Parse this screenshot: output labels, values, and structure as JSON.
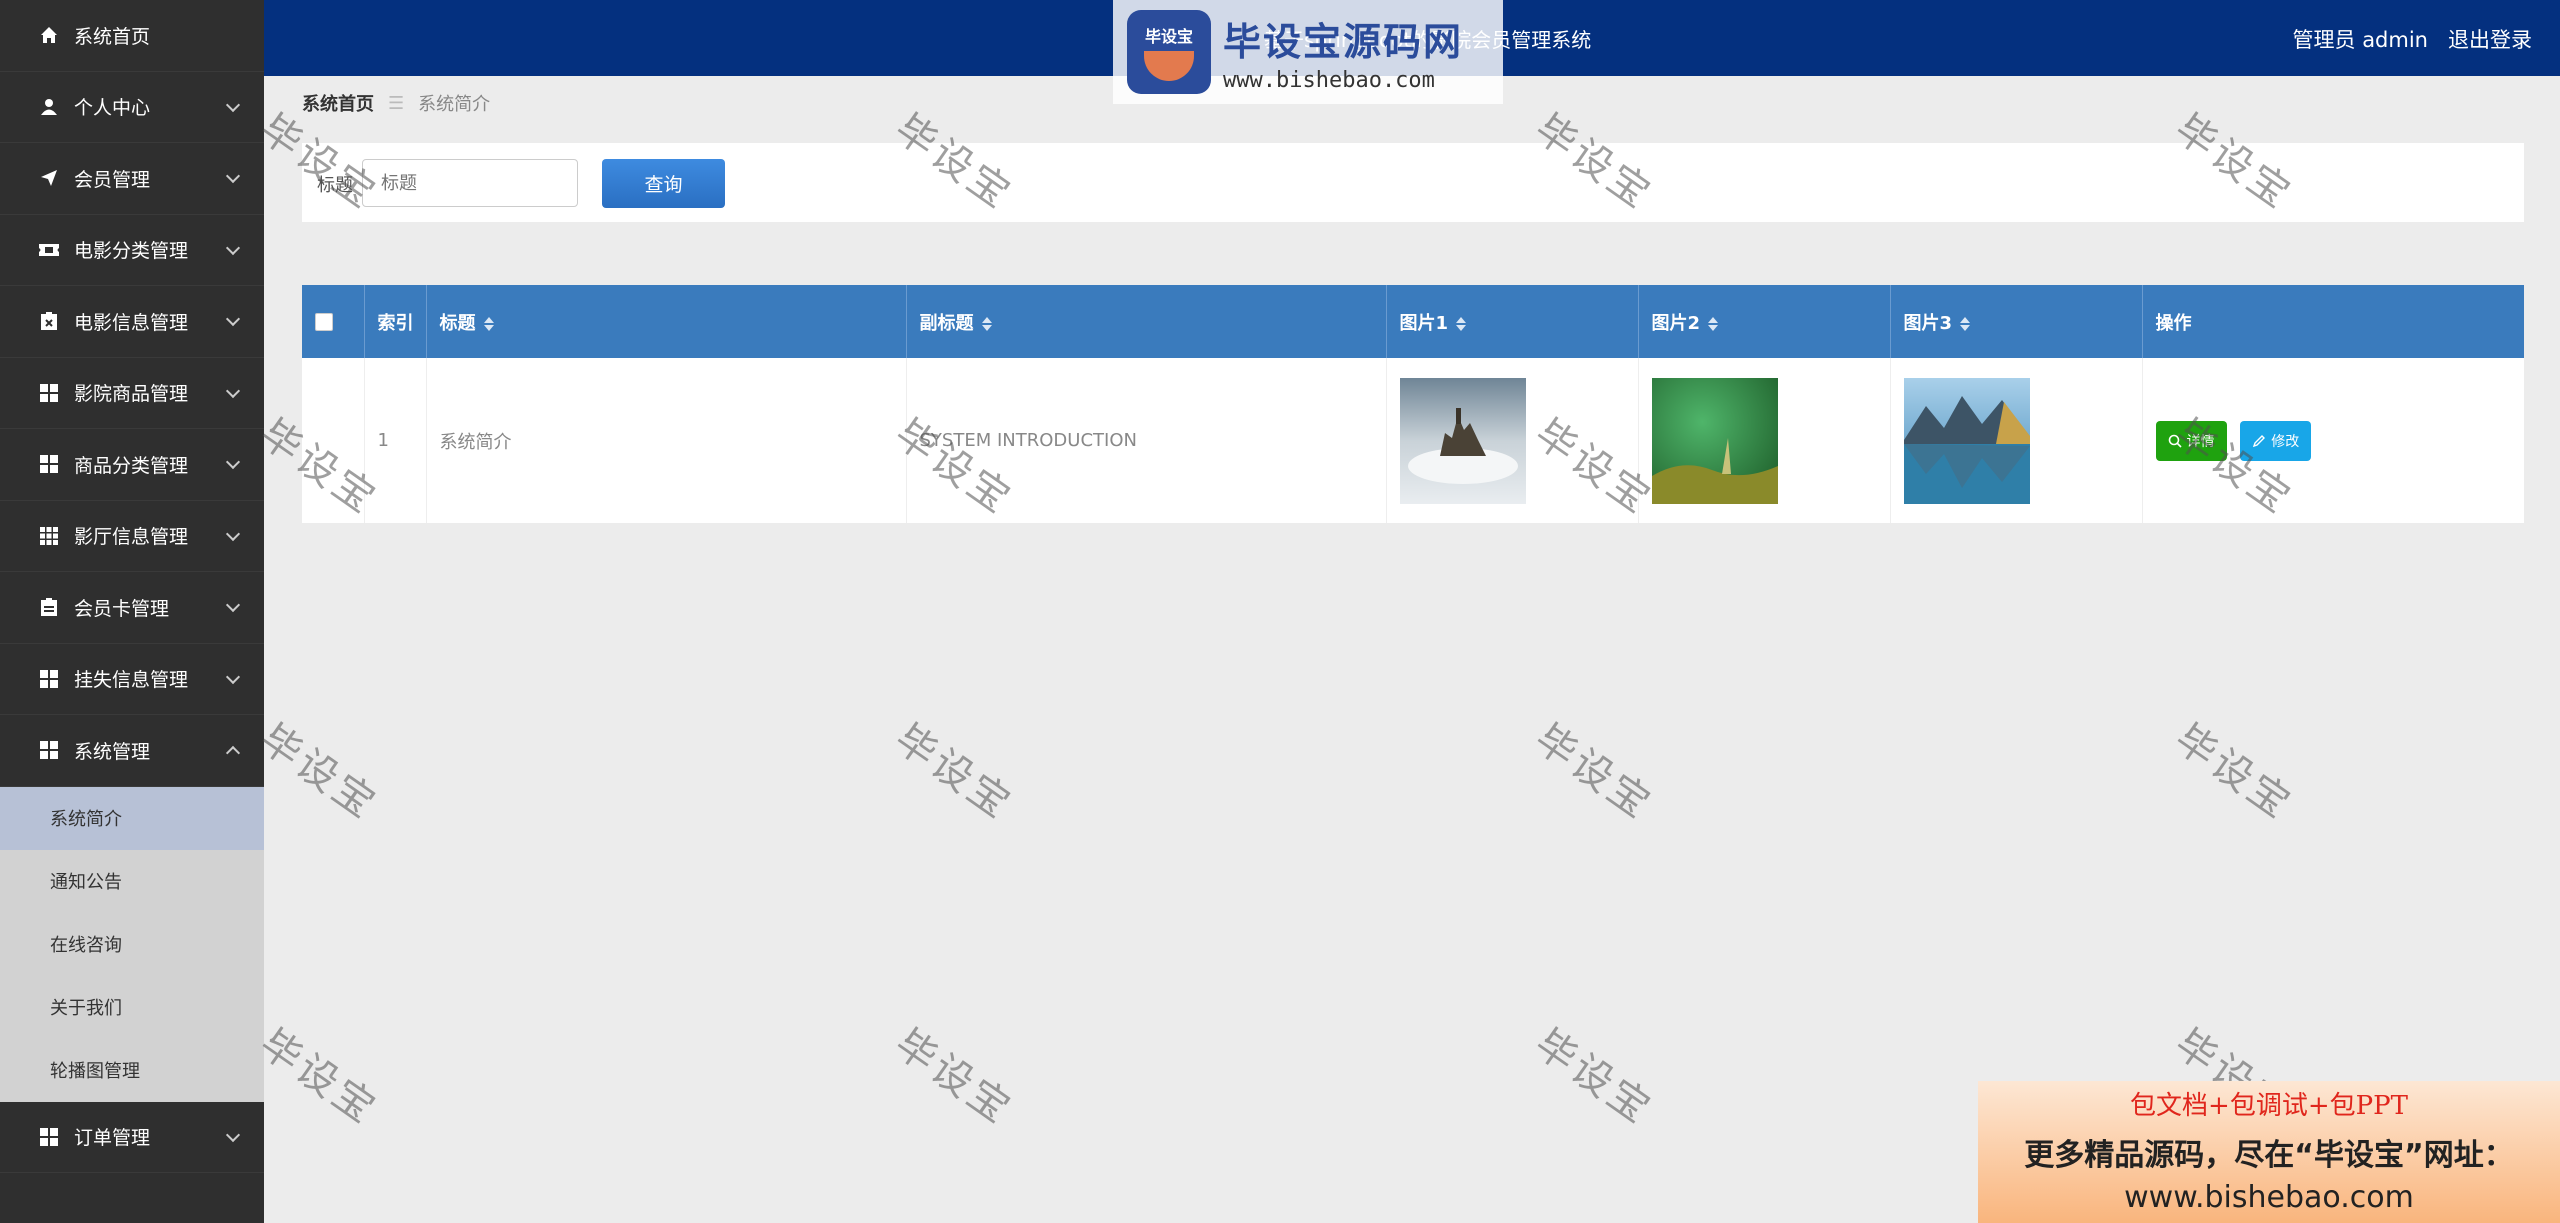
{
  "sidebar": {
    "items": [
      {
        "label": "系统首页",
        "icon": "home-icon",
        "chevron": false
      },
      {
        "label": "个人中心",
        "icon": "user-icon",
        "chevron": true
      },
      {
        "label": "会员管理",
        "icon": "paper-plane-icon",
        "chevron": true
      },
      {
        "label": "电影分类管理",
        "icon": "ticket-icon",
        "chevron": true
      },
      {
        "label": "电影信息管理",
        "icon": "clipboard-x-icon",
        "chevron": true
      },
      {
        "label": "影院商品管理",
        "icon": "grid-icon",
        "chevron": true
      },
      {
        "label": "商品分类管理",
        "icon": "grid-icon",
        "chevron": true
      },
      {
        "label": "影厅信息管理",
        "icon": "grid-9-icon",
        "chevron": true
      },
      {
        "label": "会员卡管理",
        "icon": "clipboard-icon",
        "chevron": true
      },
      {
        "label": "挂失信息管理",
        "icon": "grid-icon",
        "chevron": true
      },
      {
        "label": "系统管理",
        "icon": "grid-icon",
        "chevron": true,
        "expanded": true
      }
    ],
    "sub_items": [
      "系统简介",
      "通知公告",
      "在线咨询",
      "关于我们",
      "轮播图管理"
    ],
    "active_sub": 0,
    "bottom_item": {
      "label": "订单管理",
      "icon": "grid-icon"
    }
  },
  "header": {
    "title": "基于springboot的影院会员管理系统",
    "user": "管理员 admin",
    "logout": "退出登录"
  },
  "logo_watermark": {
    "badge": "毕设宝",
    "text": "毕设宝源码网",
    "url": "www.bishebao.com"
  },
  "breadcrumb": {
    "home": "系统首页",
    "separator": "☰",
    "current": "系统简介"
  },
  "search": {
    "label": "标题",
    "placeholder": "标题",
    "button": "查询"
  },
  "table": {
    "columns": [
      "索引",
      "标题",
      "副标题",
      "图片1",
      "图片2",
      "图片3",
      "操作"
    ],
    "rows": [
      {
        "index": "1",
        "title": "系统简介",
        "subtitle": "SYSTEM INTRODUCTION"
      }
    ],
    "actions": {
      "detail": "详情",
      "edit": "修改"
    }
  },
  "watermark_text": "毕设宝",
  "ad": {
    "line1": "包文档+包调试+包PPT",
    "line2": "更多精品源码，尽在“毕设宝”网址：",
    "line3": "www.bishebao.com"
  },
  "colors": {
    "header_bg": "#04307f",
    "sidebar_bg": "#2f2f2f",
    "table_head": "#3a7bbd",
    "detail_btn": "#1fa20f",
    "edit_btn": "#18a6e8"
  }
}
